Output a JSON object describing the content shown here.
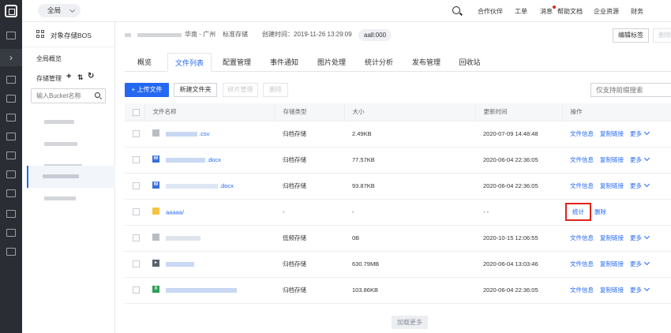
{
  "topbar": {
    "region": "全局",
    "nav": [
      "合作伙伴",
      "工单",
      "消息",
      "帮助文档",
      "企业资源",
      "财务"
    ]
  },
  "sidebar": {
    "title": "对象存储BOS",
    "overview": "全局概览",
    "mgmt": "存储管理",
    "mgmt_add": "+",
    "mgmt_sort": "⇅",
    "mgmt_refresh": "↻",
    "search_placeholder": "输入Bucket名称"
  },
  "bucket_info": {
    "region": "华南 - 广州",
    "storage_class": "标准存储",
    "created": "创建时间：2019-11-26 13:29:09",
    "badge": "aall:000",
    "edit_tags": "编辑标签",
    "delete": "删除"
  },
  "tabs": [
    "概览",
    "文件列表",
    "配置管理",
    "事件通知",
    "图片处理",
    "统计分析",
    "发布管理",
    "回收站"
  ],
  "active_tab": "文件列表",
  "toolbar": {
    "upload": "+ 上传文件",
    "new_folder": "新建文件夹",
    "fragment": "碎片管理",
    "delete": "删除",
    "search_placeholder": "仅支持前缀搜索"
  },
  "table": {
    "columns": [
      "文件名称",
      "存储类型",
      "大小",
      "更新时间",
      "操作"
    ],
    "rows": [
      {
        "name": ".csv",
        "type": "归档存储",
        "size": "2.49KB",
        "time": "2020-07-09 14:48:48",
        "icon": "image-file-icon"
      },
      {
        "name": ".docx",
        "type": "归档存储",
        "size": "77.57KB",
        "time": "2020-06-04 22:36:05",
        "icon": "word-file-icon"
      },
      {
        "name": ".docx",
        "type": "归档存储",
        "size": "93.87KB",
        "time": "2020-06-04 22:36:05",
        "icon": "word-file-icon"
      },
      {
        "name": "aaaaa/",
        "type": "-",
        "size": "-",
        "time": "- -",
        "icon": "folder-icon"
      },
      {
        "name": "",
        "type": "低频存储",
        "size": "0B",
        "time": "2020-10-15 12:06:55",
        "icon": "image-file-icon"
      },
      {
        "name": "",
        "type": "归档存储",
        "size": "630.79MB",
        "time": "2020-06-04 13:03:46",
        "icon": "video-file-icon"
      },
      {
        "name": "",
        "type": "归档存储",
        "size": "103.86KB",
        "time": "2020-06-04 22:36:05",
        "icon": "excel-file-icon"
      }
    ],
    "actions": {
      "info": "文件信息",
      "copy": "复制链接",
      "more": "更多",
      "stats": "统计",
      "delete": "删除"
    }
  },
  "load_more": "加载更多",
  "colors": {
    "accent": "#2468f2",
    "highlight": "#e2231a",
    "rail": "#2a2d33"
  }
}
